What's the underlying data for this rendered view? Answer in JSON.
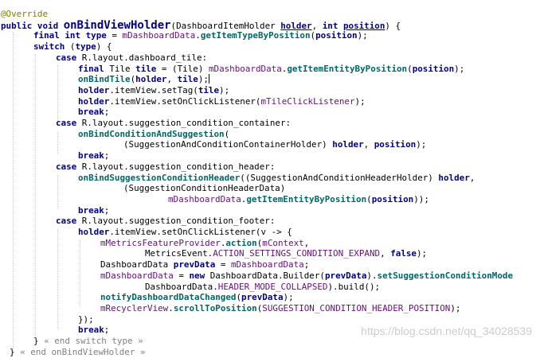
{
  "colors": {
    "background": "#ffffff",
    "keyword": "#000080",
    "annotation": "#808000",
    "field": "#660e7a",
    "method": "#006666",
    "default": "#000000",
    "comment": "#808080",
    "watermark": "#cccccc"
  },
  "code_lines": [
    {
      "indent": 1,
      "tokens": [
        {
          "text": "@Override",
          "kind": "annotation"
        }
      ]
    },
    {
      "indent": 1,
      "tokens": [
        {
          "text": "public void ",
          "kind": "keyword"
        },
        {
          "text": "onBindViewHolder",
          "kind": "method_decl"
        },
        {
          "text": "(DashboardItemHolder ",
          "kind": "default"
        },
        {
          "text": "holder",
          "kind": "param_underline"
        },
        {
          "text": ", ",
          "kind": "default"
        },
        {
          "text": "int ",
          "kind": "keyword"
        },
        {
          "text": "position",
          "kind": "param_underline"
        },
        {
          "text": ") {",
          "kind": "default"
        }
      ]
    },
    {
      "indent": 42,
      "tokens": [
        {
          "text": "final int ",
          "kind": "keyword"
        },
        {
          "text": "type",
          "kind": "local"
        },
        {
          "text": " = ",
          "kind": "default"
        },
        {
          "text": "mDashboardData",
          "kind": "field"
        },
        {
          "text": ".",
          "kind": "default"
        },
        {
          "text": "getItemTypeByPosition",
          "kind": "method_call"
        },
        {
          "text": "(",
          "kind": "default"
        },
        {
          "text": "position",
          "kind": "local"
        },
        {
          "text": ");",
          "kind": "default"
        }
      ]
    },
    {
      "indent": 42,
      "tokens": [
        {
          "text": "switch ",
          "kind": "keyword"
        },
        {
          "text": "(",
          "kind": "default"
        },
        {
          "text": "type",
          "kind": "local"
        },
        {
          "text": ") {",
          "kind": "default"
        }
      ]
    },
    {
      "indent": 70,
      "tokens": [
        {
          "text": "case ",
          "kind": "keyword"
        },
        {
          "text": "R.layout.dashboard_tile:",
          "kind": "default"
        }
      ]
    },
    {
      "indent": 98,
      "tokens": [
        {
          "text": "final ",
          "kind": "keyword"
        },
        {
          "text": "Tile ",
          "kind": "default"
        },
        {
          "text": "tile",
          "kind": "local"
        },
        {
          "text": " = (Tile) ",
          "kind": "default"
        },
        {
          "text": "mDashboardData",
          "kind": "field"
        },
        {
          "text": ".",
          "kind": "default"
        },
        {
          "text": "getItemEntityByPosition",
          "kind": "method_call"
        },
        {
          "text": "(",
          "kind": "default"
        },
        {
          "text": "position",
          "kind": "local"
        },
        {
          "text": ");",
          "kind": "default"
        }
      ]
    },
    {
      "indent": 98,
      "caret": true,
      "tokens": [
        {
          "text": "onBindTile",
          "kind": "method_call"
        },
        {
          "text": "(",
          "kind": "default"
        },
        {
          "text": "holder",
          "kind": "local"
        },
        {
          "text": ", ",
          "kind": "default"
        },
        {
          "text": "tile",
          "kind": "local"
        },
        {
          "text": ");",
          "kind": "default"
        }
      ]
    },
    {
      "indent": 98,
      "tokens": [
        {
          "text": "holder",
          "kind": "local"
        },
        {
          "text": ".itemView.setTag(",
          "kind": "default"
        },
        {
          "text": "tile",
          "kind": "local"
        },
        {
          "text": ");",
          "kind": "default"
        }
      ]
    },
    {
      "indent": 98,
      "tokens": [
        {
          "text": "holder",
          "kind": "local"
        },
        {
          "text": ".itemView.setOnClickListener(",
          "kind": "default"
        },
        {
          "text": "mTileClickListener",
          "kind": "field"
        },
        {
          "text": ");",
          "kind": "default"
        }
      ]
    },
    {
      "indent": 98,
      "tokens": [
        {
          "text": "break",
          "kind": "keyword"
        },
        {
          "text": ";",
          "kind": "default"
        }
      ]
    },
    {
      "indent": 70,
      "tokens": [
        {
          "text": "case ",
          "kind": "keyword"
        },
        {
          "text": "R.layout.suggestion_condition_container:",
          "kind": "default"
        }
      ]
    },
    {
      "indent": 98,
      "tokens": [
        {
          "text": "onBindConditionAndSuggestion",
          "kind": "method_call"
        },
        {
          "text": "(",
          "kind": "default"
        }
      ]
    },
    {
      "indent": 155,
      "tokens": [
        {
          "text": "(SuggestionAndConditionContainerHolder) ",
          "kind": "default"
        },
        {
          "text": "holder",
          "kind": "local"
        },
        {
          "text": ", ",
          "kind": "default"
        },
        {
          "text": "position",
          "kind": "local"
        },
        {
          "text": ");",
          "kind": "default"
        }
      ]
    },
    {
      "indent": 98,
      "tokens": [
        {
          "text": "break",
          "kind": "keyword"
        },
        {
          "text": ";",
          "kind": "default"
        }
      ]
    },
    {
      "indent": 70,
      "tokens": [
        {
          "text": "case ",
          "kind": "keyword"
        },
        {
          "text": "R.layout.suggestion_condition_header:",
          "kind": "default"
        }
      ]
    },
    {
      "indent": 98,
      "tokens": [
        {
          "text": "onBindSuggestionConditionHeader",
          "kind": "method_call"
        },
        {
          "text": "((SuggestionAndConditionHeaderHolder) ",
          "kind": "default"
        },
        {
          "text": "holder",
          "kind": "local"
        },
        {
          "text": ",",
          "kind": "default"
        }
      ]
    },
    {
      "indent": 155,
      "tokens": [
        {
          "text": "(SuggestionConditionHeaderData)",
          "kind": "default"
        }
      ]
    },
    {
      "indent": 211,
      "tokens": [
        {
          "text": "mDashboardData",
          "kind": "field"
        },
        {
          "text": ".",
          "kind": "default"
        },
        {
          "text": "getItemEntityByPosition",
          "kind": "method_call"
        },
        {
          "text": "(",
          "kind": "default"
        },
        {
          "text": "position",
          "kind": "local"
        },
        {
          "text": "));",
          "kind": "default"
        }
      ]
    },
    {
      "indent": 98,
      "tokens": [
        {
          "text": "break",
          "kind": "keyword"
        },
        {
          "text": ";",
          "kind": "default"
        }
      ]
    },
    {
      "indent": 70,
      "tokens": [
        {
          "text": "case ",
          "kind": "keyword"
        },
        {
          "text": "R.layout.suggestion_condition_footer:",
          "kind": "default"
        }
      ]
    },
    {
      "indent": 98,
      "tokens": [
        {
          "text": "holder",
          "kind": "local"
        },
        {
          "text": ".itemView.setOnClickListener(v -> {",
          "kind": "default"
        }
      ]
    },
    {
      "indent": 126,
      "tokens": [
        {
          "text": "mMetricsFeatureProvider",
          "kind": "field"
        },
        {
          "text": ".",
          "kind": "default"
        },
        {
          "text": "action",
          "kind": "method_call"
        },
        {
          "text": "(",
          "kind": "default"
        },
        {
          "text": "mContext",
          "kind": "field"
        },
        {
          "text": ",",
          "kind": "default"
        }
      ]
    },
    {
      "indent": 182,
      "tokens": [
        {
          "text": "MetricsEvent.",
          "kind": "default"
        },
        {
          "text": "ACTION_SETTINGS_CONDITION_EXPAND",
          "kind": "constant"
        },
        {
          "text": ", ",
          "kind": "default"
        },
        {
          "text": "false",
          "kind": "keyword"
        },
        {
          "text": ");",
          "kind": "default"
        }
      ]
    },
    {
      "indent": 126,
      "tokens": [
        {
          "text": "DashboardData ",
          "kind": "default"
        },
        {
          "text": "prevData",
          "kind": "local"
        },
        {
          "text": " = ",
          "kind": "default"
        },
        {
          "text": "mDashboardData",
          "kind": "field"
        },
        {
          "text": ";",
          "kind": "default"
        }
      ]
    },
    {
      "indent": 126,
      "tokens": [
        {
          "text": "mDashboardData",
          "kind": "field"
        },
        {
          "text": " = ",
          "kind": "default"
        },
        {
          "text": "new ",
          "kind": "keyword"
        },
        {
          "text": "DashboardData.Builder(",
          "kind": "default"
        },
        {
          "text": "prevData",
          "kind": "local"
        },
        {
          "text": ").",
          "kind": "default"
        },
        {
          "text": "setSuggestionConditionMode",
          "kind": "method_call"
        }
      ]
    },
    {
      "indent": 182,
      "tokens": [
        {
          "text": "DashboardData.",
          "kind": "default"
        },
        {
          "text": "HEADER_MODE_COLLAPSED",
          "kind": "constant"
        },
        {
          "text": ").build();",
          "kind": "default"
        }
      ]
    },
    {
      "indent": 126,
      "tokens": [
        {
          "text": "notifyDashboardDataChanged",
          "kind": "method_call"
        },
        {
          "text": "(",
          "kind": "default"
        },
        {
          "text": "prevData",
          "kind": "local"
        },
        {
          "text": ");",
          "kind": "default"
        }
      ]
    },
    {
      "indent": 126,
      "tokens": [
        {
          "text": "mRecyclerView",
          "kind": "field"
        },
        {
          "text": ".",
          "kind": "default"
        },
        {
          "text": "scrollToPosition",
          "kind": "method_call"
        },
        {
          "text": "(",
          "kind": "default"
        },
        {
          "text": "SUGGESTION_CONDITION_HEADER_POSITION",
          "kind": "constant"
        },
        {
          "text": ");",
          "kind": "default"
        }
      ]
    },
    {
      "indent": 98,
      "tokens": [
        {
          "text": "});",
          "kind": "default"
        }
      ]
    },
    {
      "indent": 98,
      "tokens": [
        {
          "text": "break",
          "kind": "keyword"
        },
        {
          "text": ";",
          "kind": "default"
        }
      ]
    },
    {
      "indent": 42,
      "tokens": [
        {
          "text": "} ",
          "kind": "default"
        },
        {
          "text": "« end switch type »",
          "kind": "comment"
        }
      ]
    },
    {
      "indent": 12,
      "tokens": [
        {
          "text": "} ",
          "kind": "default"
        },
        {
          "text": "« end onBindViewHolder »",
          "kind": "comment"
        }
      ]
    }
  ],
  "watermark": "https://blog.csdn.net/qq_34028539"
}
